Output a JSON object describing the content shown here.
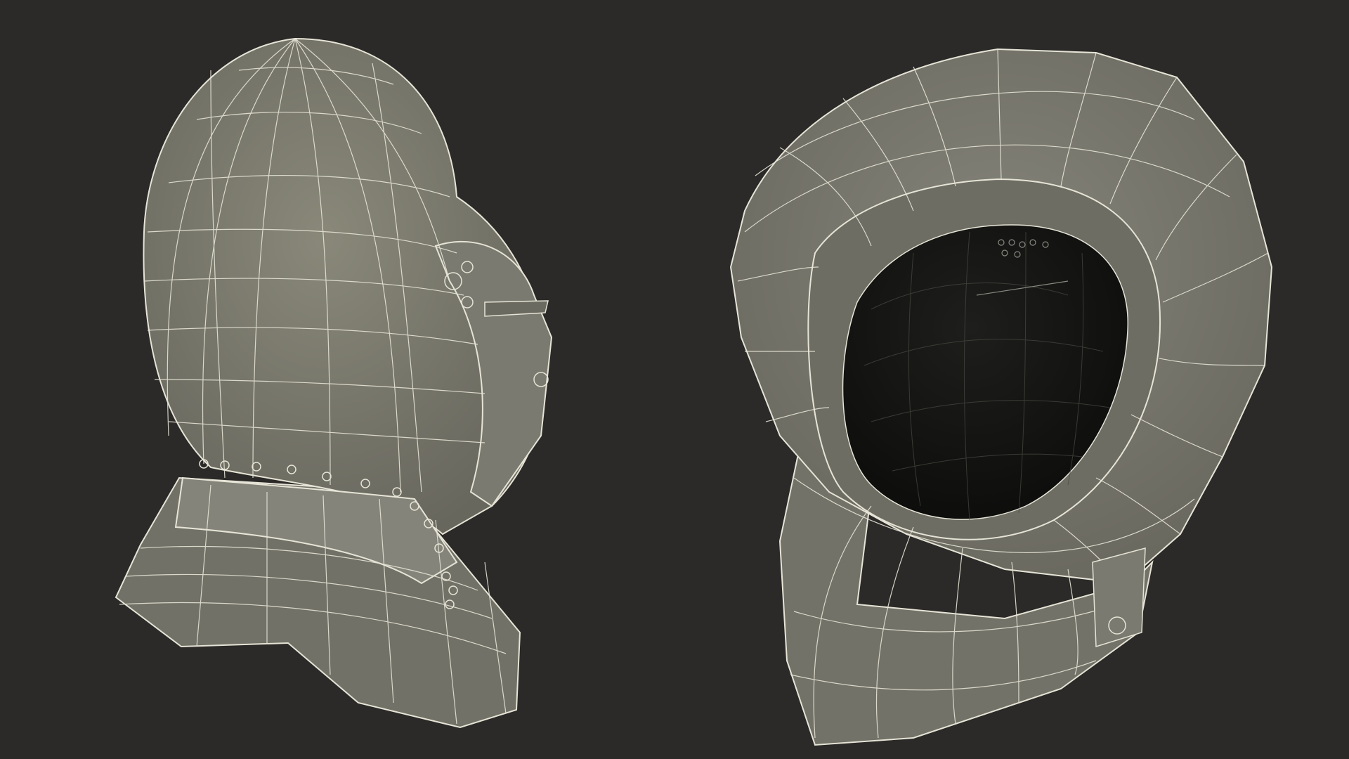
{
  "scene": {
    "background_color": "#2b2a28",
    "surface_color": "#7d7c71",
    "surface_dark_color": "#65645b",
    "interior_color": "#161614",
    "wire_color": "#e6e4d6"
  },
  "models": [
    {
      "view": "side",
      "object": "helmet-wireframe"
    },
    {
      "view": "top-down",
      "object": "helmet-wireframe"
    }
  ]
}
